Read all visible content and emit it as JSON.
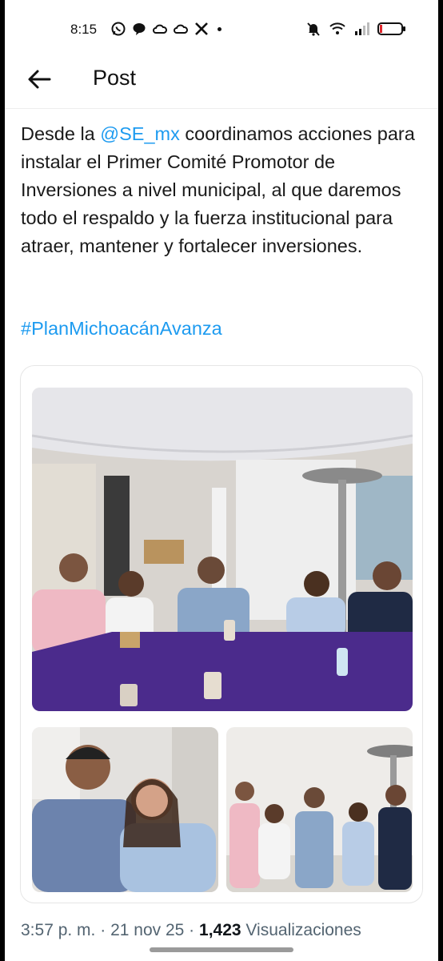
{
  "status_bar": {
    "time": "8:15",
    "left_icons": [
      "whatsapp-icon",
      "chat-icon",
      "cloud-icon",
      "cloud-icon",
      "x-icon",
      "dot-icon"
    ],
    "right_icons": [
      "mute-icon",
      "wifi-icon",
      "signal-icon",
      "battery-icon"
    ],
    "battery_color": "#e0282e"
  },
  "header": {
    "title": "Post"
  },
  "post": {
    "text_before_mention": "Desde la ",
    "mention": "@SE_mx",
    "text_after_mention": " coordinamos acciones para instalar el Primer Comité Promotor de Inversiones a nivel municipal, al que daremos todo el respaldo y la fuerza institucional para atraer, mantener y fortalecer inversiones.",
    "hashtag": "#PlanMichoacánAvanza",
    "link_color": "#1d9bf0"
  },
  "media": {
    "photos": [
      "meeting-photo",
      "portrait-photo",
      "group-photo"
    ]
  },
  "meta": {
    "time": "3:57 p. m.",
    "separator": "·",
    "date": "21 nov 25",
    "views_count": "1,423",
    "views_label": "Visualizaciones"
  }
}
